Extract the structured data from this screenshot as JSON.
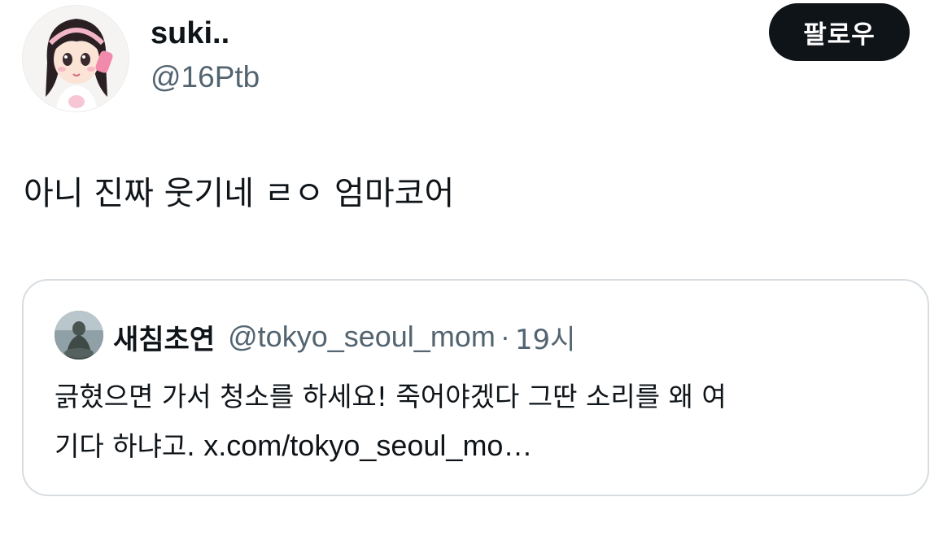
{
  "author": {
    "display_name": "suki..",
    "handle": "@16Ptb",
    "avatar_icon": "cartoon-girl-avatar-icon"
  },
  "follow_button": {
    "label": "팔로우"
  },
  "tweet": {
    "text": "아니 진짜 웃기네 ㄹㅇ 엄마코어"
  },
  "quoted_tweet": {
    "avatar_icon": "buddha-statue-avatar-icon",
    "display_name": "새침초연",
    "handle": "@tokyo_seoul_mom",
    "separator": "·",
    "time": "19시",
    "body_line1": "긁혔으면 가서 청소를 하세요! 죽어야겠다 그딴 소리를 왜 여",
    "body_line2_text": "기다 하냐고. ",
    "link": "x.com/tokyo_seoul_mo…"
  },
  "colors": {
    "text_primary": "#0f1419",
    "text_secondary": "#536471",
    "button_bg": "#0f1419",
    "card_border": "#d7dde1"
  }
}
